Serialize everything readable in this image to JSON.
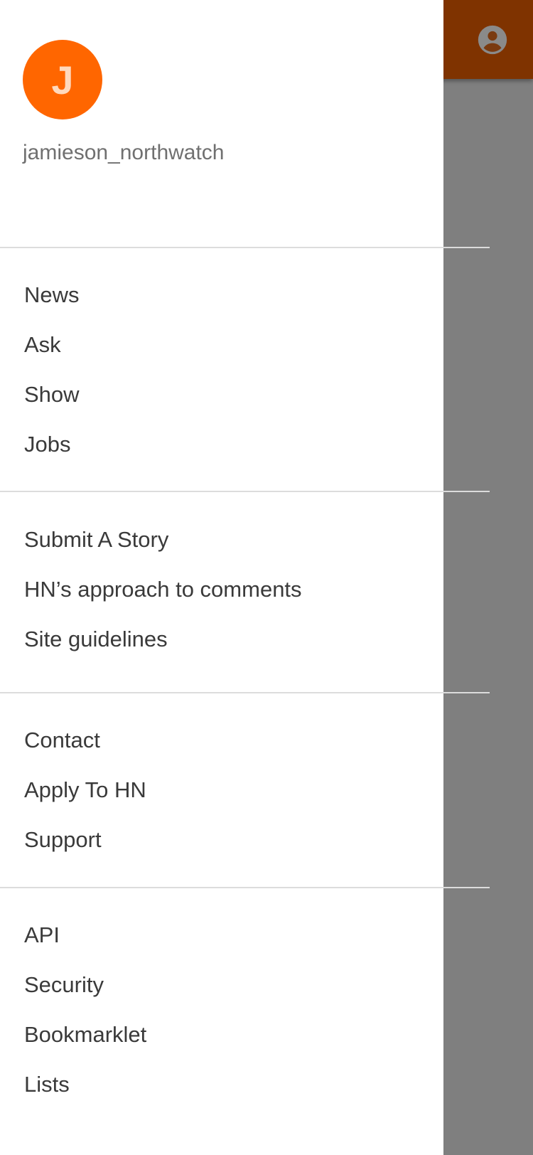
{
  "colors": {
    "accent": "#ff6600",
    "scrim": "rgba(0,0,0,0.5)",
    "menu_text": "#3a3a3a",
    "username_text": "#707070",
    "divider": "#dcdcdc",
    "icon": "#8a8a8a"
  },
  "app_bar": {
    "account_icon": "account-circle-icon"
  },
  "drawer": {
    "avatar_initial": "J",
    "username": "jamieson_northwatch",
    "sections": [
      {
        "items": [
          "News",
          "Ask",
          "Show",
          "Jobs"
        ]
      },
      {
        "items": [
          "Submit A Story",
          "HN’s approach to comments",
          "Site guidelines"
        ]
      },
      {
        "items": [
          "Contact",
          "Apply To HN",
          "Support"
        ]
      },
      {
        "items": [
          "API",
          "Security",
          "Bookmarklet",
          "Lists"
        ]
      }
    ]
  }
}
